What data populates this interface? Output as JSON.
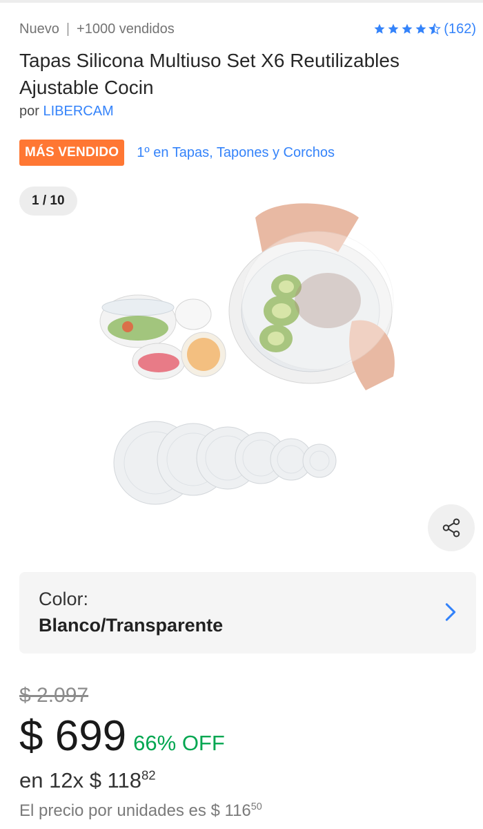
{
  "header": {
    "condition": "Nuevo",
    "separator": "|",
    "sold": "+1000 vendidos",
    "rating_count": "(162)",
    "rating_value": 4.5
  },
  "product": {
    "title": "Tapas Silicona Multiuso Set X6 Reutilizables Ajustable Cocin",
    "seller_prefix": "por",
    "seller_name": "LIBERCAM",
    "badge": "MÁS VENDIDO",
    "rank_text": "1º en Tapas, Tapones y Corchos"
  },
  "gallery": {
    "counter": "1 / 10",
    "share_icon": "share-icon"
  },
  "variant": {
    "label": "Color:",
    "value": "Blanco/Transparente"
  },
  "pricing": {
    "old_price": "$ 2.097",
    "price": "$ 699",
    "discount": "66% OFF",
    "installments_prefix": "en 12x $ 118",
    "installments_cents": "82",
    "unit_prefix": "El precio por unidades es $ 116",
    "unit_cents": "50"
  },
  "colors": {
    "link": "#3483fa",
    "badge": "#ff7733",
    "discount": "#00a650"
  }
}
